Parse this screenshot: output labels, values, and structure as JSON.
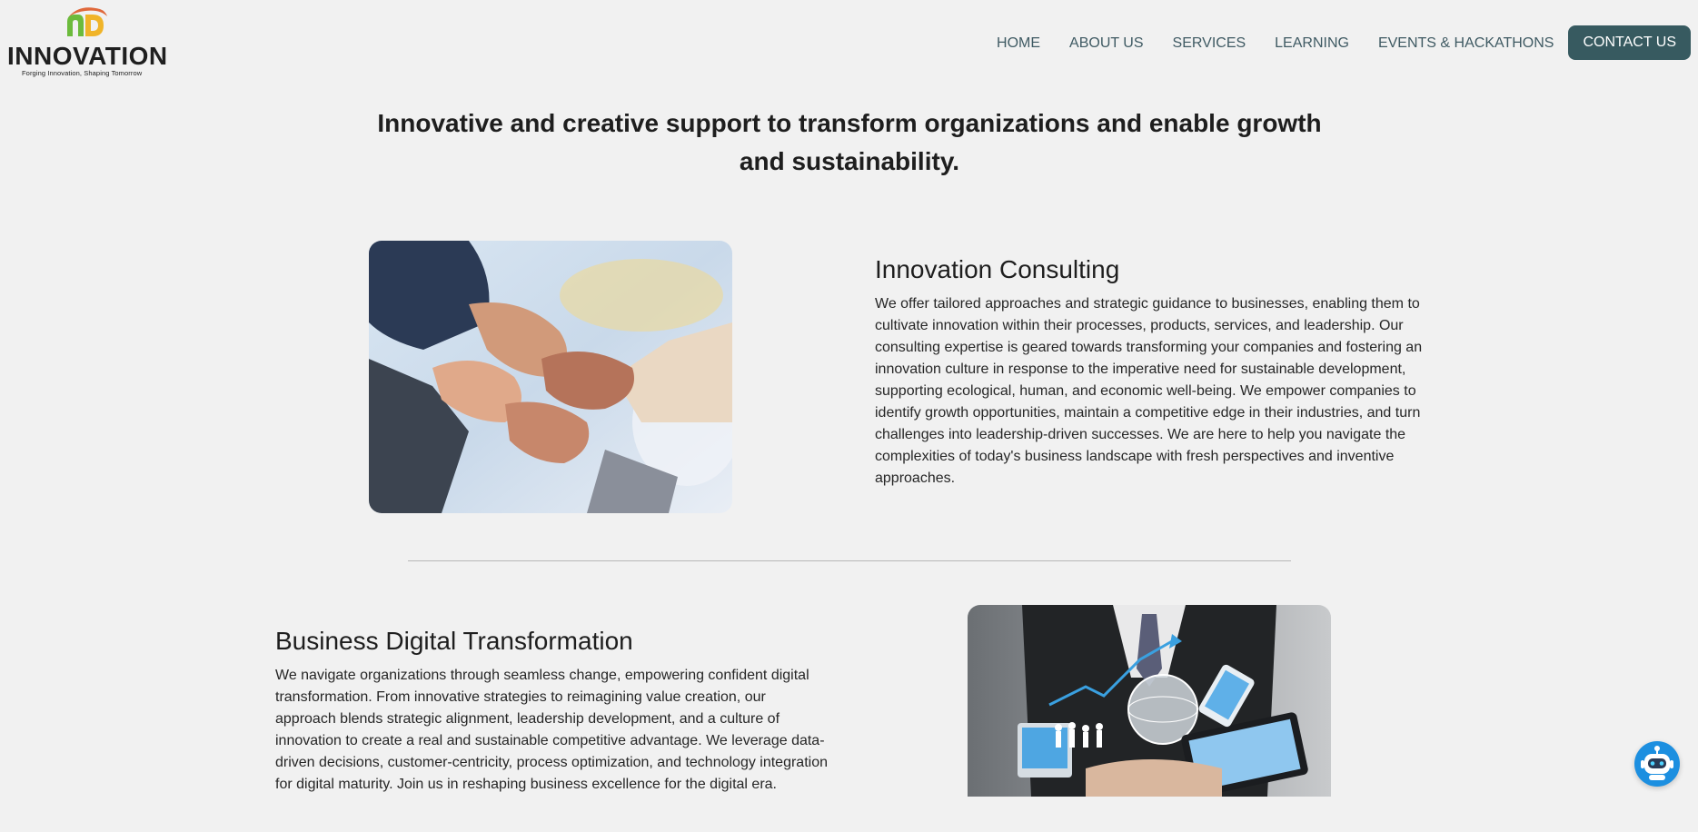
{
  "brand": {
    "name": "INNOVATION",
    "tagline": "Forging Innovation, Shaping Tomorrow"
  },
  "nav": {
    "items": [
      {
        "label": "HOME"
      },
      {
        "label": "ABOUT US"
      },
      {
        "label": "SERVICES"
      },
      {
        "label": "LEARNING"
      },
      {
        "label": "EVENTS & HACKATHONS"
      }
    ],
    "cta": "CONTACT US"
  },
  "hero": {
    "title_line1": "Innovative and creative support to transform organizations and enable growth",
    "title_line2": "and sustainability."
  },
  "sections": [
    {
      "title": "Innovation Consulting",
      "body": "We offer tailored approaches and strategic guidance to businesses, enabling them to cultivate innovation within their processes, products, services, and leadership. Our consulting expertise is geared towards transforming your companies and fostering an innovation culture in response to the imperative need for sustainable development, supporting ecological, human, and economic well-being. We empower companies to identify growth opportunities, maintain a competitive edge in their industries, and turn challenges into leadership-driven successes. We are here to help you navigate the complexities of today's business landscape with fresh perspectives and inventive approaches."
    },
    {
      "title": "Business Digital Transformation",
      "body": "We navigate organizations through seamless change, empowering confident digital transformation. From innovative strategies to reimagining value creation, our approach blends strategic alignment, leadership development, and a culture of innovation to create a real and sustainable competitive advantage. We leverage data-driven decisions, customer-centricity, process optimization, and technology integration for digital maturity. Join us in reshaping business excellence for the digital era."
    }
  ],
  "colors": {
    "background": "#f1f1f1",
    "nav_text": "#3f5a63",
    "cta_bg": "#375a60",
    "chatbot": "#1c8fe0"
  },
  "icons": {
    "chatbot": "robot-icon"
  }
}
